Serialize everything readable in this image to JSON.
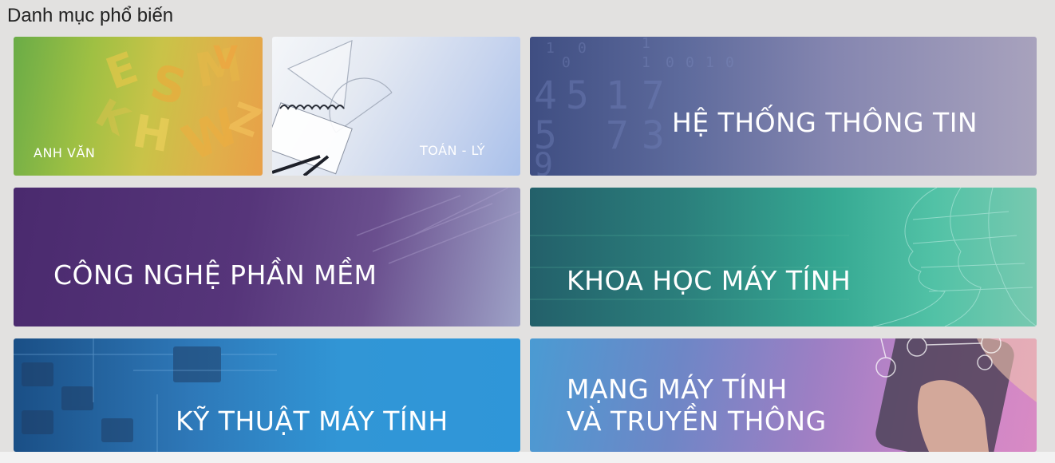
{
  "section": {
    "title": "Danh mục phổ biến"
  },
  "categories": [
    {
      "id": "anh-van",
      "label": "ANH VĂN"
    },
    {
      "id": "toan-ly",
      "label": "TOÁN - LÝ"
    },
    {
      "id": "he-thong-thong-tin",
      "label": "HỆ THỐNG THÔNG TIN"
    },
    {
      "id": "cong-nghe-phan-mem",
      "label": "CÔNG NGHỆ PHẦN MỀM"
    },
    {
      "id": "khoa-hoc-may-tinh",
      "label": "KHOA HỌC MÁY TÍNH"
    },
    {
      "id": "ky-thuat-may-tinh",
      "label": "KỸ THUẬT MÁY TÍNH"
    },
    {
      "id": "mang-may-tinh",
      "label_line1": "MẠNG MÁY TÍNH",
      "label_line2": "VÀ TRUYỀN THÔNG"
    }
  ],
  "decor": {
    "binary_digits": [
      "1",
      "0",
      "1",
      "0",
      "1",
      "0",
      "0",
      "1",
      "0"
    ],
    "large_digits": [
      "4",
      "5",
      "1",
      "7",
      "5",
      "7",
      "3",
      "9"
    ]
  },
  "colors": {
    "page_background": "#e2e1e0",
    "label_text": "#ffffff",
    "title_text": "#222222"
  }
}
